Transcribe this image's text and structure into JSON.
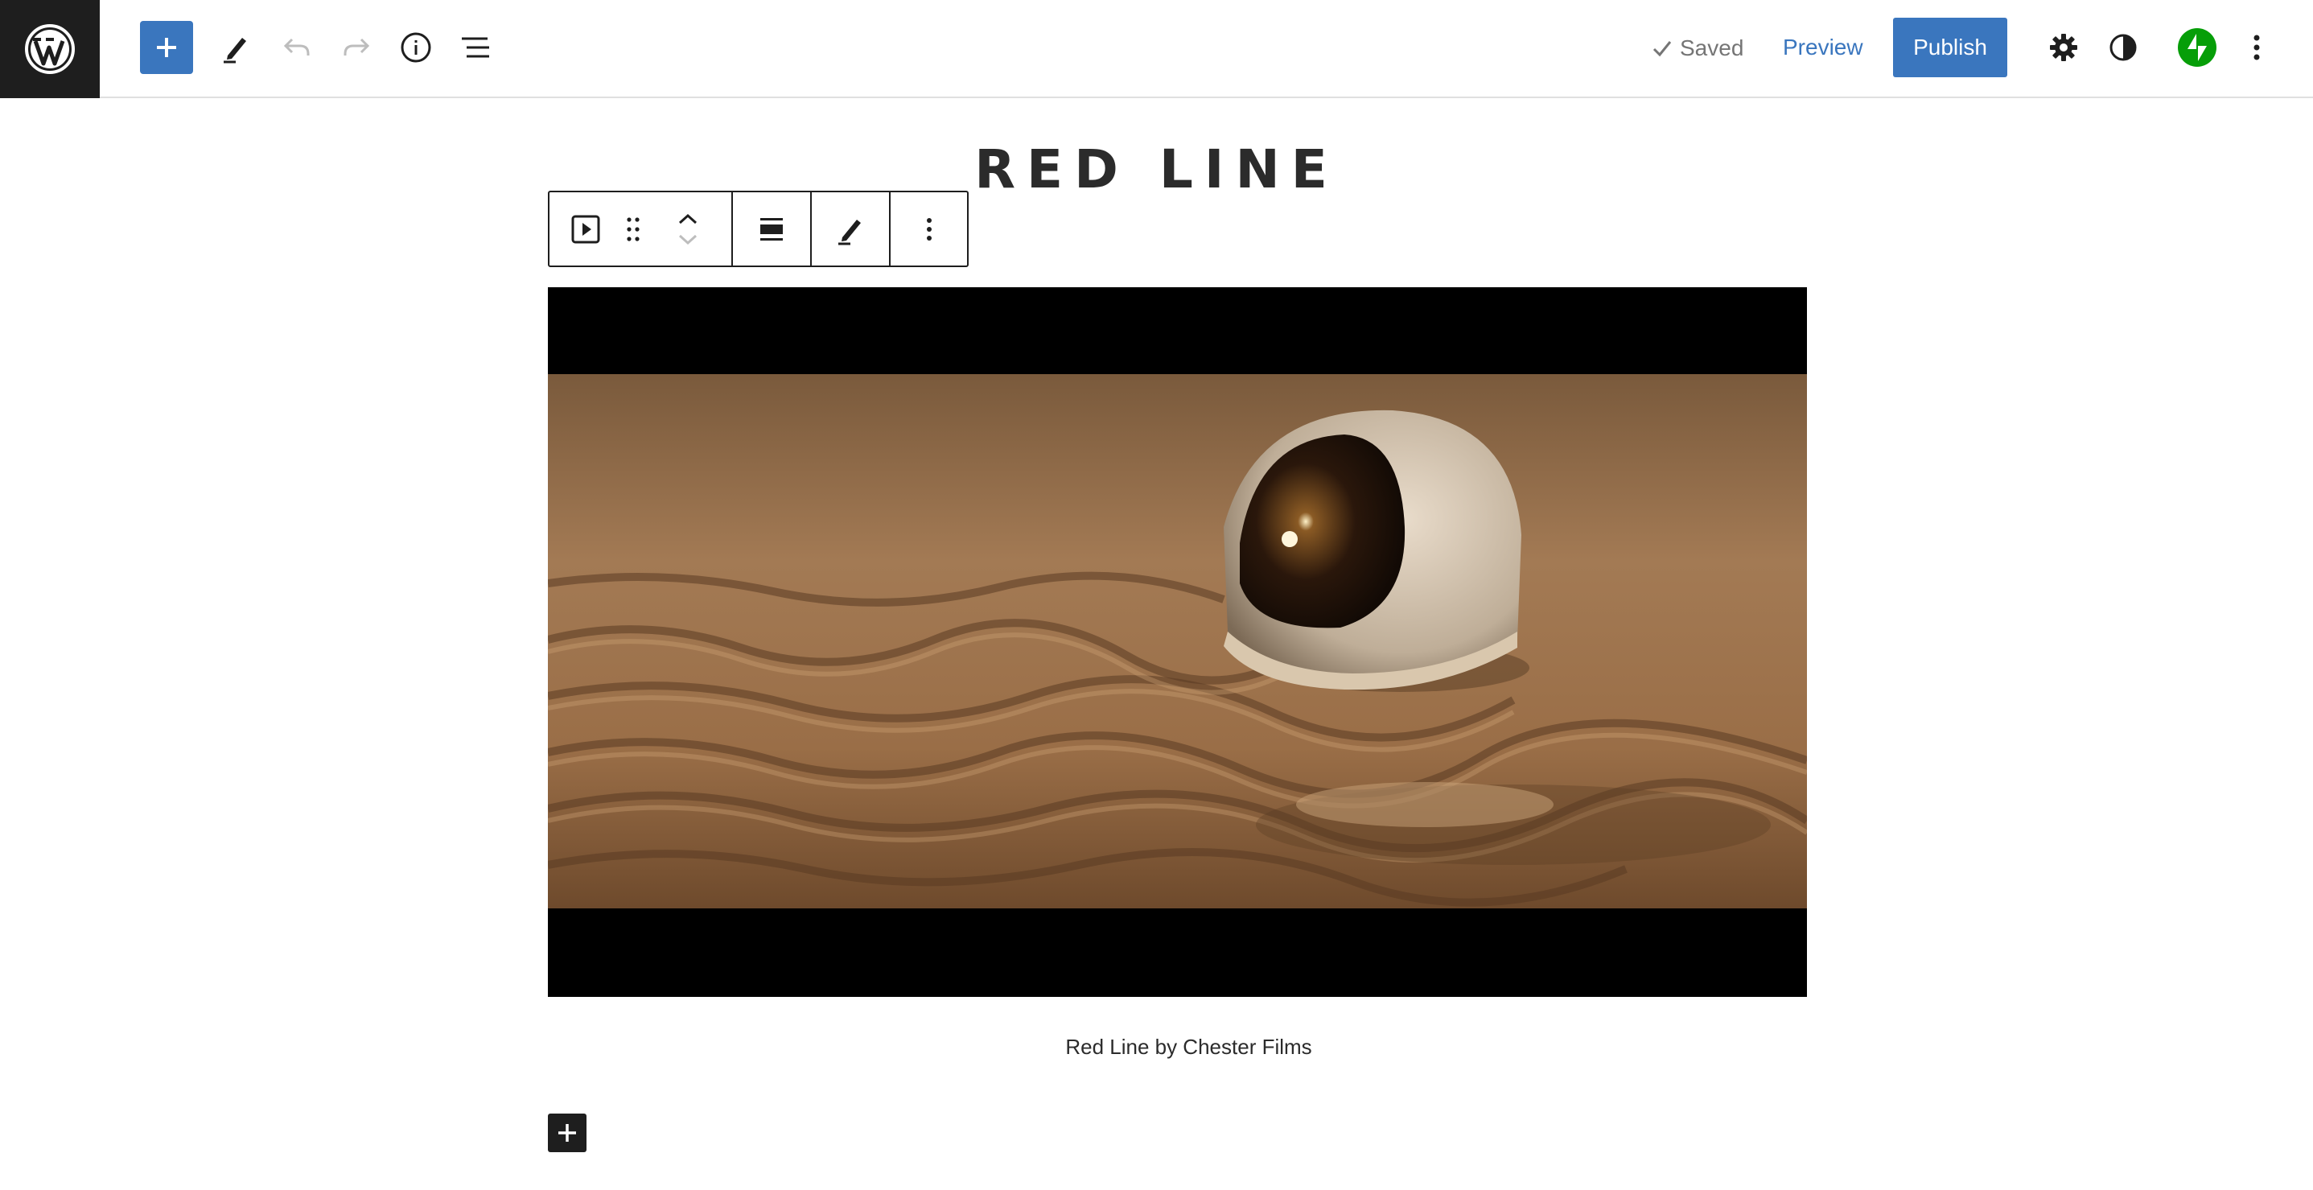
{
  "header": {
    "logo_icon": "wordpress-icon",
    "toolbar": {
      "add_icon": "plus-icon",
      "tools_icon": "pencil-icon",
      "undo_icon": "undo-icon",
      "redo_icon": "redo-icon",
      "details_icon": "info-icon",
      "list_view_icon": "list-view-icon"
    },
    "status": {
      "saved_label": "Saved",
      "icon": "check-icon"
    },
    "preview_label": "Preview",
    "publish_label": "Publish",
    "settings_icon": "gear-icon",
    "styles_icon": "contrast-icon",
    "jetpack_icon": "jetpack-icon",
    "options_icon": "vertical-ellipsis-icon"
  },
  "post": {
    "title": "RED LINE",
    "caption": "Red Line by Chester Films"
  },
  "block_toolbar": {
    "block_type_icon": "video-icon",
    "drag_icon": "drag-handle-icon",
    "move_up_icon": "chevron-up-icon",
    "move_down_icon": "chevron-down-icon",
    "align_icon": "align-center-icon",
    "edit_icon": "pencil-icon",
    "options_icon": "vertical-ellipsis-icon"
  },
  "colors": {
    "accent": "#3a76be",
    "dark": "#1e1e1e",
    "jetpack": "#069e08",
    "muted_text": "#757575"
  }
}
